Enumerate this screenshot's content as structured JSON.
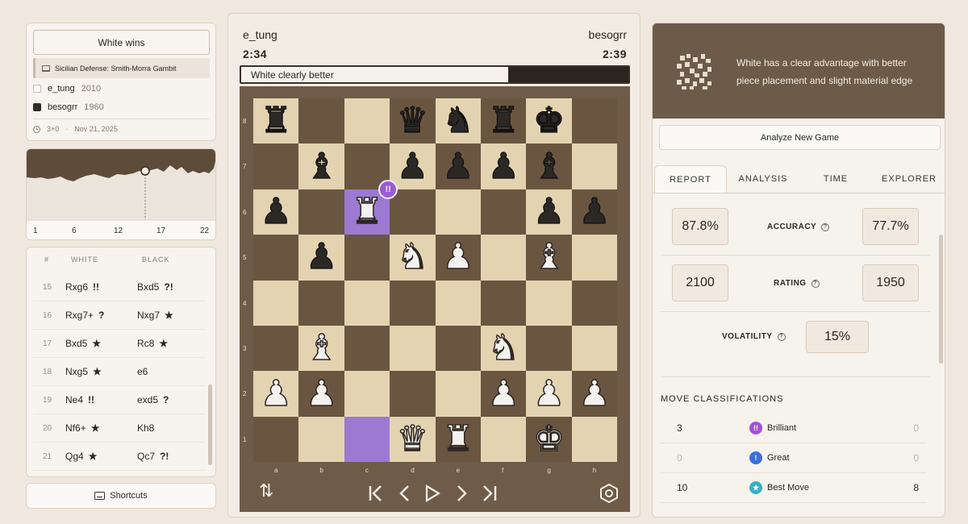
{
  "game": {
    "result": "White wins",
    "opening": "Sicilian Defense: Smith-Morra Gambit",
    "white": {
      "name": "e_tung",
      "rating": "2010"
    },
    "black": {
      "name": "besogrr",
      "rating": "1960"
    },
    "time_control": "3+0",
    "date": "Nov 21, 2025"
  },
  "graph": {
    "x_labels": [
      "1",
      "6",
      "12",
      "17",
      "22"
    ]
  },
  "moves": {
    "headers": {
      "num": "#",
      "white": "WHITE",
      "black": "BLACK"
    },
    "rows": [
      {
        "num": "15",
        "white": "Rxg6",
        "white_badge": "!!",
        "black": "Bxd5",
        "black_badge": "?!"
      },
      {
        "num": "16",
        "white": "Rxg7+",
        "white_badge": "?",
        "black": "Nxg7",
        "black_badge": "★"
      },
      {
        "num": "17",
        "white": "Bxd5",
        "white_badge": "★",
        "black": "Rc8",
        "black_badge": "★"
      },
      {
        "num": "18",
        "white": "Nxg5",
        "white_badge": "★",
        "black": "e6",
        "black_badge": ""
      },
      {
        "num": "19",
        "white": "Ne4",
        "white_badge": "!!",
        "black": "exd5",
        "black_badge": "?"
      },
      {
        "num": "20",
        "white": "Nf6+",
        "white_badge": "★",
        "black": "Kh8",
        "black_badge": ""
      },
      {
        "num": "21",
        "white": "Qg4",
        "white_badge": "★",
        "black": "Qc7",
        "black_badge": "?!"
      }
    ]
  },
  "shortcuts_label": "Shortcuts",
  "board": {
    "top_player": "e_tung",
    "bottom_player": "besogrr",
    "top_clock": "2:34",
    "bottom_clock": "2:39",
    "eval_text": "White clearly better",
    "eval_white_fraction": 0.69,
    "ranks": [
      "8",
      "7",
      "6",
      "5",
      "4",
      "3",
      "2",
      "1"
    ],
    "files": [
      "a",
      "b",
      "c",
      "d",
      "e",
      "f",
      "g",
      "h"
    ],
    "highlight_squares": [
      "c6",
      "c1"
    ],
    "brilliant_badge": "!!",
    "brilliant_square": "c6",
    "pieces": [
      {
        "sq": "a8",
        "p": "r",
        "c": "b"
      },
      {
        "sq": "d8",
        "p": "q",
        "c": "b"
      },
      {
        "sq": "e8",
        "p": "n",
        "c": "b"
      },
      {
        "sq": "f8",
        "p": "r",
        "c": "b"
      },
      {
        "sq": "g8",
        "p": "k",
        "c": "b"
      },
      {
        "sq": "b7",
        "p": "b",
        "c": "b"
      },
      {
        "sq": "d7",
        "p": "p",
        "c": "b"
      },
      {
        "sq": "e7",
        "p": "p",
        "c": "b"
      },
      {
        "sq": "f7",
        "p": "p",
        "c": "b"
      },
      {
        "sq": "g7",
        "p": "b",
        "c": "b"
      },
      {
        "sq": "a6",
        "p": "p",
        "c": "b"
      },
      {
        "sq": "c6",
        "p": "r",
        "c": "w"
      },
      {
        "sq": "g6",
        "p": "p",
        "c": "b"
      },
      {
        "sq": "h6",
        "p": "p",
        "c": "b"
      },
      {
        "sq": "b5",
        "p": "p",
        "c": "b"
      },
      {
        "sq": "d5",
        "p": "n",
        "c": "w"
      },
      {
        "sq": "e5",
        "p": "p",
        "c": "w"
      },
      {
        "sq": "g5",
        "p": "b",
        "c": "w"
      },
      {
        "sq": "b3",
        "p": "b",
        "c": "w"
      },
      {
        "sq": "f3",
        "p": "n",
        "c": "w"
      },
      {
        "sq": "a2",
        "p": "p",
        "c": "w"
      },
      {
        "sq": "b2",
        "p": "p",
        "c": "w"
      },
      {
        "sq": "f2",
        "p": "p",
        "c": "w"
      },
      {
        "sq": "g2",
        "p": "p",
        "c": "w"
      },
      {
        "sq": "h2",
        "p": "p",
        "c": "w"
      },
      {
        "sq": "d1",
        "p": "q",
        "c": "w"
      },
      {
        "sq": "e1",
        "p": "r",
        "c": "w"
      },
      {
        "sq": "g1",
        "p": "k",
        "c": "w"
      }
    ]
  },
  "panel": {
    "summary": "White has a clear advantage with better piece placement and slight material edge",
    "analyze_button": "Analyze New Game",
    "tabs": [
      "REPORT",
      "ANALYSIS",
      "TIME",
      "EXPLORER"
    ],
    "active_tab": "REPORT",
    "accuracy": {
      "label": "ACCURACY",
      "white": "87.8%",
      "black": "77.7%"
    },
    "rating": {
      "label": "RATING",
      "white": "2100",
      "black": "1950"
    },
    "volatility": {
      "label": "VOLATILITY",
      "value": "15%"
    },
    "classifications_title": "MOVE CLASSIFICATIONS",
    "classifications": [
      {
        "white": "3",
        "name": "Brilliant",
        "black": "0",
        "icon": "!!",
        "color": "#a34fd4"
      },
      {
        "white": "0",
        "name": "Great",
        "black": "0",
        "icon": "!",
        "color": "#3a6fd8"
      },
      {
        "white": "10",
        "name": "Best Move",
        "black": "8",
        "icon": "★",
        "color": "#3bb0c0"
      }
    ]
  },
  "colors": {
    "light_square": "#e4d3b0",
    "dark_square": "#6a5640",
    "highlight": "#9c7ad2",
    "panel_header": "#6d5a48"
  }
}
